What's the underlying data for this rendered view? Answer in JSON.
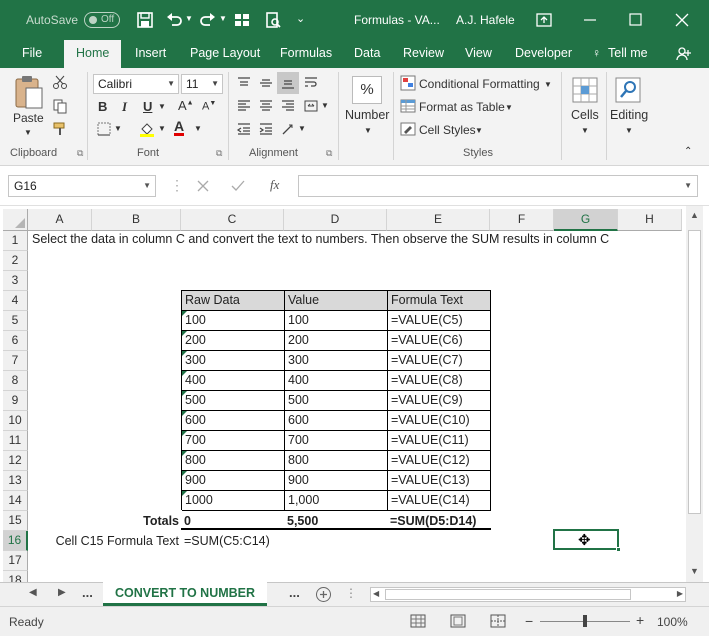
{
  "window": {
    "autosave_label": "AutoSave",
    "autosave_state": "Off",
    "document_title": "Formulas - VA...",
    "user_name": "A.J. Hafele"
  },
  "tabs": [
    "File",
    "Home",
    "Insert",
    "Page Layout",
    "Formulas",
    "Data",
    "Review",
    "View",
    "Developer",
    "Tell me"
  ],
  "active_tab": "Home",
  "ribbon": {
    "clipboard": {
      "label": "Clipboard",
      "paste": "Paste"
    },
    "font": {
      "label": "Font",
      "font_name": "Calibri",
      "font_size": "11",
      "bold": "B",
      "italic": "I",
      "underline": "U"
    },
    "alignment": {
      "label": "Alignment"
    },
    "number": {
      "label": "Number",
      "percent_glyph": "%"
    },
    "styles": {
      "label": "Styles",
      "conditional_formatting": "Conditional Formatting",
      "format_as_table": "Format as Table",
      "cell_styles": "Cell Styles"
    },
    "cells": {
      "label": "Cells"
    },
    "editing": {
      "label": "Editing"
    }
  },
  "formula_bar": {
    "name_box": "G16",
    "formula": "",
    "fx": "fx"
  },
  "columns": [
    "A",
    "B",
    "C",
    "D",
    "E",
    "F",
    "G",
    "H"
  ],
  "rows": [
    "1",
    "2",
    "3",
    "4",
    "5",
    "6",
    "7",
    "8",
    "9",
    "10",
    "11",
    "12",
    "13",
    "14",
    "15",
    "16",
    "17",
    "18"
  ],
  "sheet": {
    "instruction": "Select the data in column C and convert the text to numbers.  Then observe the SUM results in column C",
    "headers": [
      "Raw Data",
      "Value",
      "Formula Text"
    ],
    "data_rows": [
      [
        "100",
        "100",
        "=VALUE(C5)"
      ],
      [
        "200",
        "200",
        "=VALUE(C6)"
      ],
      [
        "300",
        "300",
        "=VALUE(C7)"
      ],
      [
        "400",
        "400",
        "=VALUE(C8)"
      ],
      [
        "500",
        "500",
        "=VALUE(C9)"
      ],
      [
        "600",
        "600",
        "=VALUE(C10)"
      ],
      [
        "700",
        "700",
        "=VALUE(C11)"
      ],
      [
        "800",
        "800",
        "=VALUE(C12)"
      ],
      [
        "900",
        "900",
        "=VALUE(C13)"
      ],
      [
        "1000",
        "1,000",
        "=VALUE(C14)"
      ]
    ],
    "totals_label": "Totals",
    "totals": [
      "0",
      "5,500",
      "=SUM(D5:D14)"
    ],
    "formula_note_label": "Cell C15 Formula Text",
    "formula_note_value": "=SUM(C5:C14)",
    "selected_cell": "G16"
  },
  "sheet_tabs": {
    "active": "CONVERT TO NUMBER",
    "ellipsis": "..."
  },
  "status": {
    "ready": "Ready",
    "zoom": "100%"
  },
  "colors": {
    "accent": "#217346",
    "header_fill": "#d9d9d9",
    "error_indicator": "#1e7145"
  }
}
